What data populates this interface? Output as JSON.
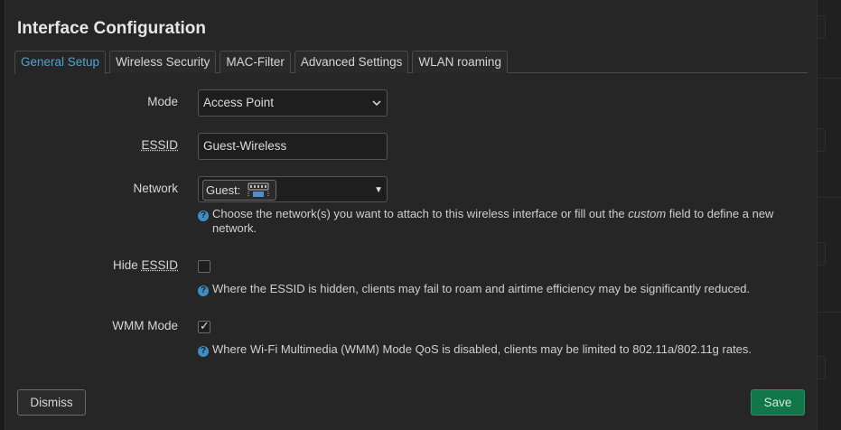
{
  "title": "Interface Configuration",
  "tabs": [
    {
      "label": "General Setup",
      "active": true
    },
    {
      "label": "Wireless Security",
      "active": false
    },
    {
      "label": "MAC-Filter",
      "active": false
    },
    {
      "label": "Advanced Settings",
      "active": false
    },
    {
      "label": "WLAN roaming",
      "active": false
    }
  ],
  "mode": {
    "label": "Mode",
    "value": "Access Point"
  },
  "essid": {
    "label": "ESSID",
    "value": "Guest-Wireless"
  },
  "network": {
    "label": "Network",
    "selected": "Guest:",
    "help_before": "Choose the network(s) you want to attach to this wireless interface or fill out the ",
    "help_em": "custom",
    "help_after": " field to define a new",
    "help_line2": "network."
  },
  "hide_essid": {
    "label": "Hide ESSID",
    "checked": false,
    "help": "Where the ESSID is hidden, clients may fail to roam and airtime efficiency may be significantly reduced."
  },
  "wmm_mode": {
    "label": "WMM Mode",
    "checked": true,
    "help": "Where Wi-Fi Multimedia (WMM) Mode QoS is disabled, clients may be limited to 802.11a/802.11g rates."
  },
  "buttons": {
    "dismiss": "Dismiss",
    "save": "Save"
  },
  "colors": {
    "accent": "#4fa3d1",
    "save": "#11774a",
    "help_icon": "#3b8fc4"
  }
}
